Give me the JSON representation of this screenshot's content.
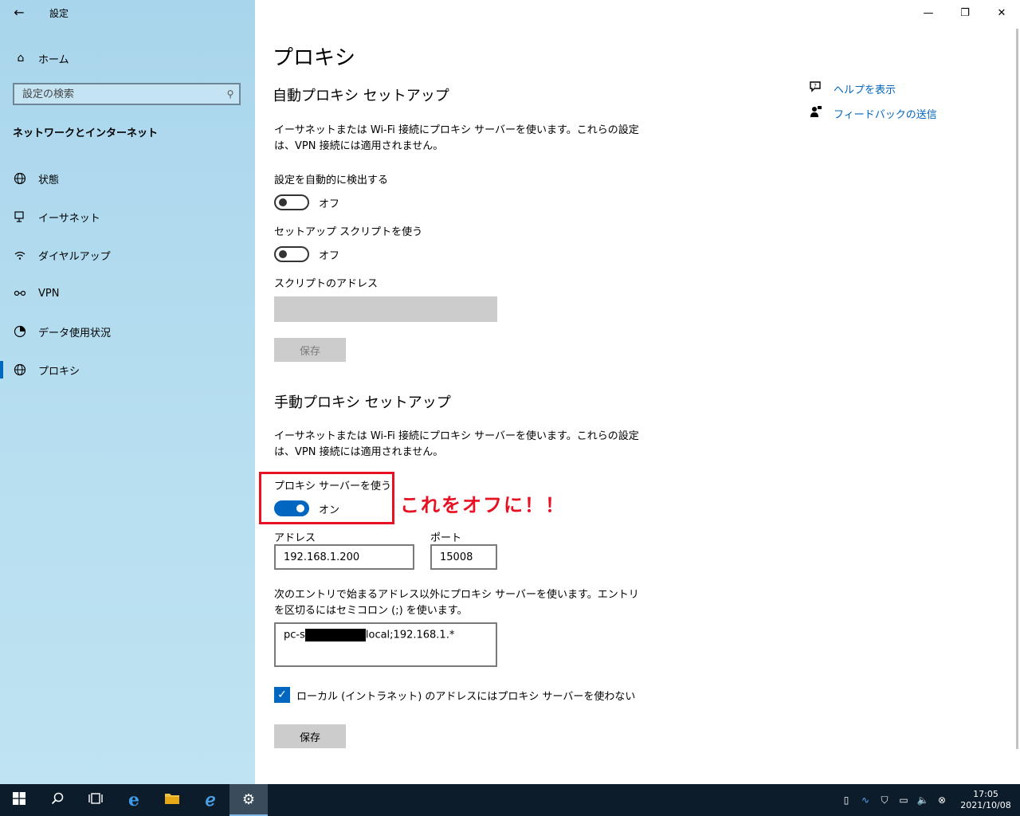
{
  "window": {
    "title": "設定",
    "back_icon": "←",
    "minimize": "—",
    "restore": "❐",
    "close": "✕"
  },
  "sidebar": {
    "home_label": "ホーム",
    "search_placeholder": "設定の検索",
    "section_title": "ネットワークとインターネット",
    "items": [
      {
        "label": "状態",
        "icon": "globe-status-icon"
      },
      {
        "label": "イーサネット",
        "icon": "ethernet-icon"
      },
      {
        "label": "ダイヤルアップ",
        "icon": "dialup-icon"
      },
      {
        "label": "VPN",
        "icon": "vpn-icon"
      },
      {
        "label": "データ使用状況",
        "icon": "data-usage-icon"
      },
      {
        "label": "プロキシ",
        "icon": "globe-icon"
      }
    ],
    "active_item": "プロキシ"
  },
  "main": {
    "title": "プロキシ",
    "auto": {
      "heading": "自動プロキシ セットアップ",
      "description": "イーサネットまたは Wi-Fi 接続にプロキシ サーバーを使います。これらの設定は、VPN 接続には適用されません。",
      "detect_label": "設定を自動的に検出する",
      "detect_state": "オフ",
      "script_label": "セットアップ スクリプトを使う",
      "script_state": "オフ",
      "address_label": "スクリプトのアドレス",
      "save_label": "保存"
    },
    "manual": {
      "heading": "手動プロキシ セットアップ",
      "description": "イーサネットまたは Wi-Fi 接続にプロキシ サーバーを使います。これらの設定は、VPN 接続には適用されません。",
      "use_proxy_label": "プロキシ サーバーを使う",
      "use_proxy_state": "オン",
      "address_label": "アドレス",
      "address_value": "192.168.1.200",
      "port_label": "ポート",
      "port_value": "15008",
      "exceptions_description": "次のエントリで始まるアドレス以外にプロキシ サーバーを使います。エントリを区切るにはセミコロン (;) を使います。",
      "exceptions_prefix": "pc-s",
      "exceptions_suffix": "local;192.168.1.*",
      "local_bypass_label": "ローカル (イントラネット) のアドレスにはプロキシ サーバーを使わない",
      "local_bypass_checked": true,
      "save_label": "保存"
    },
    "annotation": "これをオフに！！",
    "help": {
      "help_label": "ヘルプを表示",
      "feedback_label": "フィードバックの送信"
    }
  },
  "taskbar": {
    "time": "17:05",
    "date": "2021/10/08"
  },
  "colors": {
    "accent": "#0067c0",
    "annotation_red": "#e81123",
    "sidebar_bg": "#b0daee",
    "taskbar_bg": "#0d1c2b"
  }
}
